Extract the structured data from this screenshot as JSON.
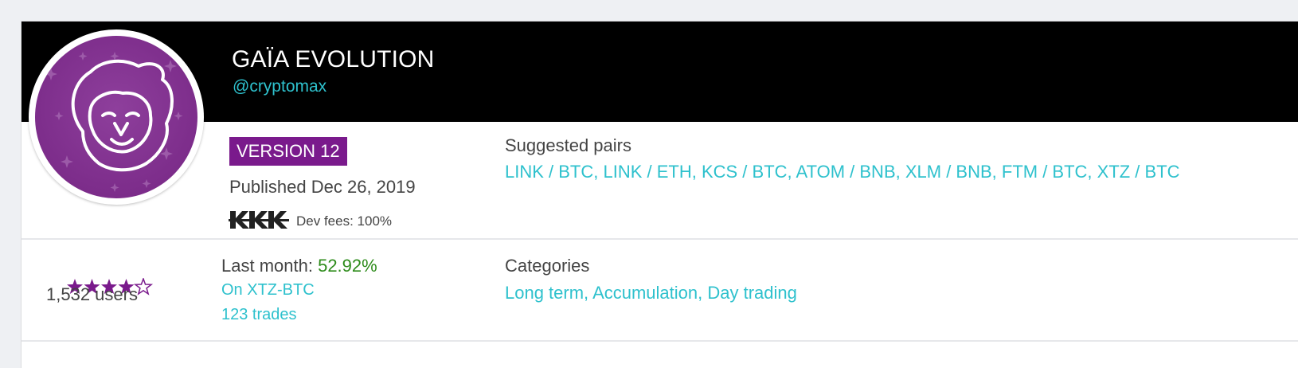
{
  "bot": {
    "name": "GAÏA EVOLUTION",
    "handle": "@cryptomax",
    "avatar_icon": "lion-face-icon",
    "version": "VERSION 12",
    "published": "Published Dec 26, 2019",
    "dev_logo": "dev-logo-icon",
    "dev_fees": "Dev fees: 100%"
  },
  "pairs": {
    "title": "Suggested pairs",
    "list": "LINK / BTC, LINK / ETH, KCS / BTC, ATOM / BNB, XLM / BNB, FTM / BTC, XTZ / BTC"
  },
  "rating": {
    "stars": 4,
    "max": 5,
    "users": "1,532 users"
  },
  "performance": {
    "label": "Last month: ",
    "value": "52.92%",
    "pair": "On XTZ-BTC",
    "trades": "123 trades"
  },
  "categories": {
    "title": "Categories",
    "list": "Long term, Accumulation, Day trading"
  },
  "colors": {
    "accent": "#7a1a8c",
    "teal": "#2ec1cd",
    "green": "#2d8b1a"
  }
}
